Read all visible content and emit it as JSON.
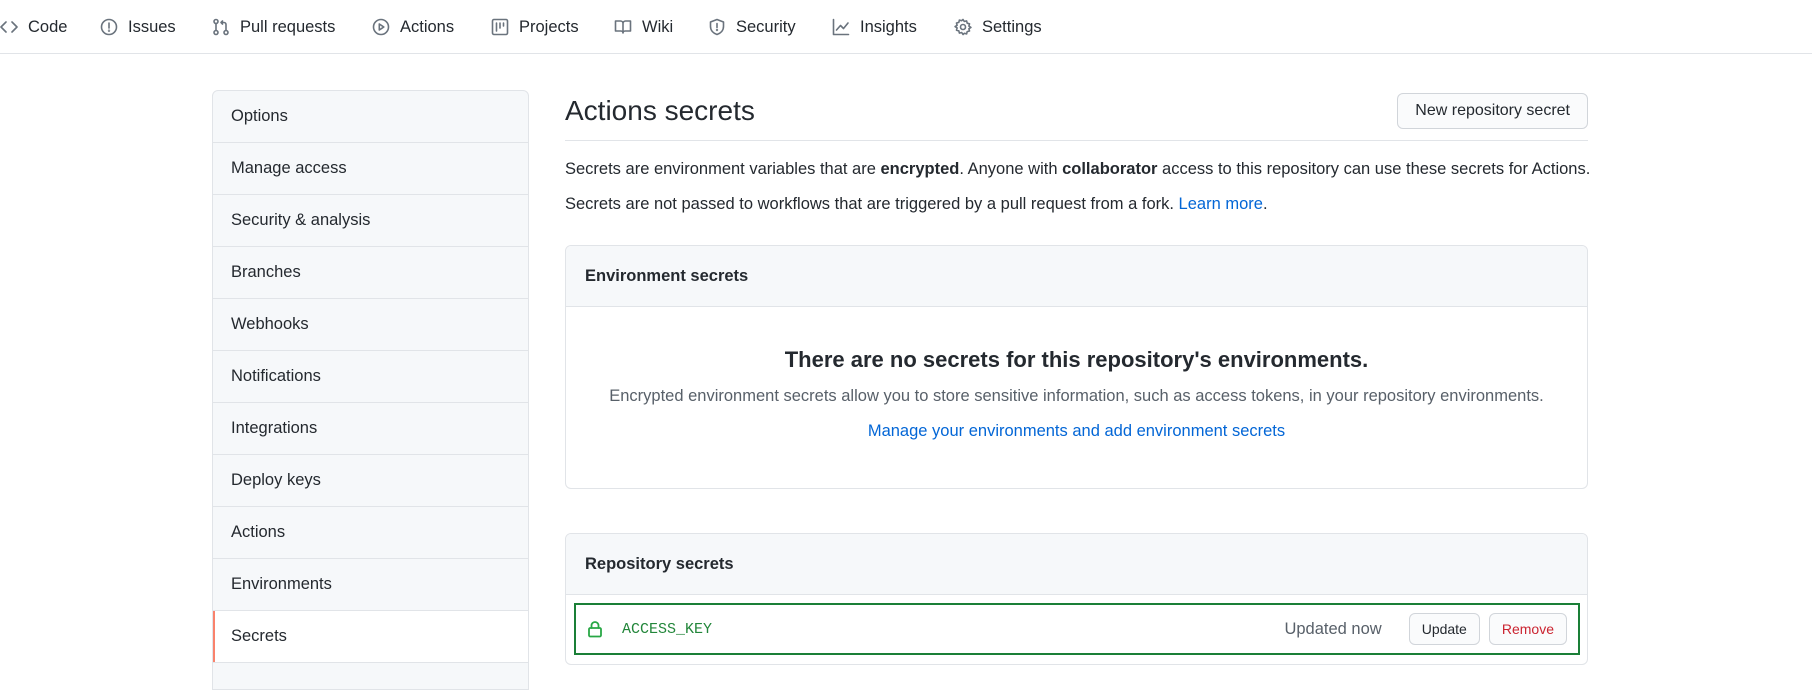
{
  "repo_nav": {
    "tabs": [
      {
        "label": "Code",
        "icon": "code-icon"
      },
      {
        "label": "Issues",
        "icon": "issue-icon"
      },
      {
        "label": "Pull requests",
        "icon": "pull-request-icon"
      },
      {
        "label": "Actions",
        "icon": "play-icon"
      },
      {
        "label": "Projects",
        "icon": "project-icon"
      },
      {
        "label": "Wiki",
        "icon": "book-icon"
      },
      {
        "label": "Security",
        "icon": "shield-icon"
      },
      {
        "label": "Insights",
        "icon": "graph-icon"
      },
      {
        "label": "Settings",
        "icon": "gear-icon"
      }
    ]
  },
  "sidebar": {
    "items": [
      {
        "label": "Options"
      },
      {
        "label": "Manage access"
      },
      {
        "label": "Security & analysis"
      },
      {
        "label": "Branches"
      },
      {
        "label": "Webhooks"
      },
      {
        "label": "Notifications"
      },
      {
        "label": "Integrations"
      },
      {
        "label": "Deploy keys"
      },
      {
        "label": "Actions"
      },
      {
        "label": "Environments"
      },
      {
        "label": "Secrets",
        "selected": true
      }
    ]
  },
  "main": {
    "title": "Actions secrets",
    "new_button": "New repository secret",
    "desc1": {
      "part1": "Secrets are environment variables that are ",
      "bold1": "encrypted",
      "part2": ". Anyone with ",
      "bold2": "collaborator",
      "part3": " access to this repository can use these secrets for Actions."
    },
    "desc2": {
      "text": "Secrets are not passed to workflows that are triggered by a pull request from a fork. ",
      "link": "Learn more",
      "end": "."
    },
    "environment_secrets": {
      "header": "Environment secrets",
      "blank_title": "There are no secrets for this repository's environments.",
      "blank_text": "Encrypted environment secrets allow you to store sensitive information, such as access tokens, in your repository environments.",
      "manage_link": "Manage your environments and add environment secrets"
    },
    "repository_secrets": {
      "header": "Repository secrets",
      "rows": [
        {
          "name": "ACCESS_KEY",
          "updated": "Updated now",
          "update_label": "Update",
          "remove_label": "Remove"
        }
      ]
    }
  },
  "colors": {
    "link": "#0366d6",
    "selected_accent": "#f9826c",
    "secret_highlight": "#1a7f37",
    "remove_text": "#cb2431"
  }
}
